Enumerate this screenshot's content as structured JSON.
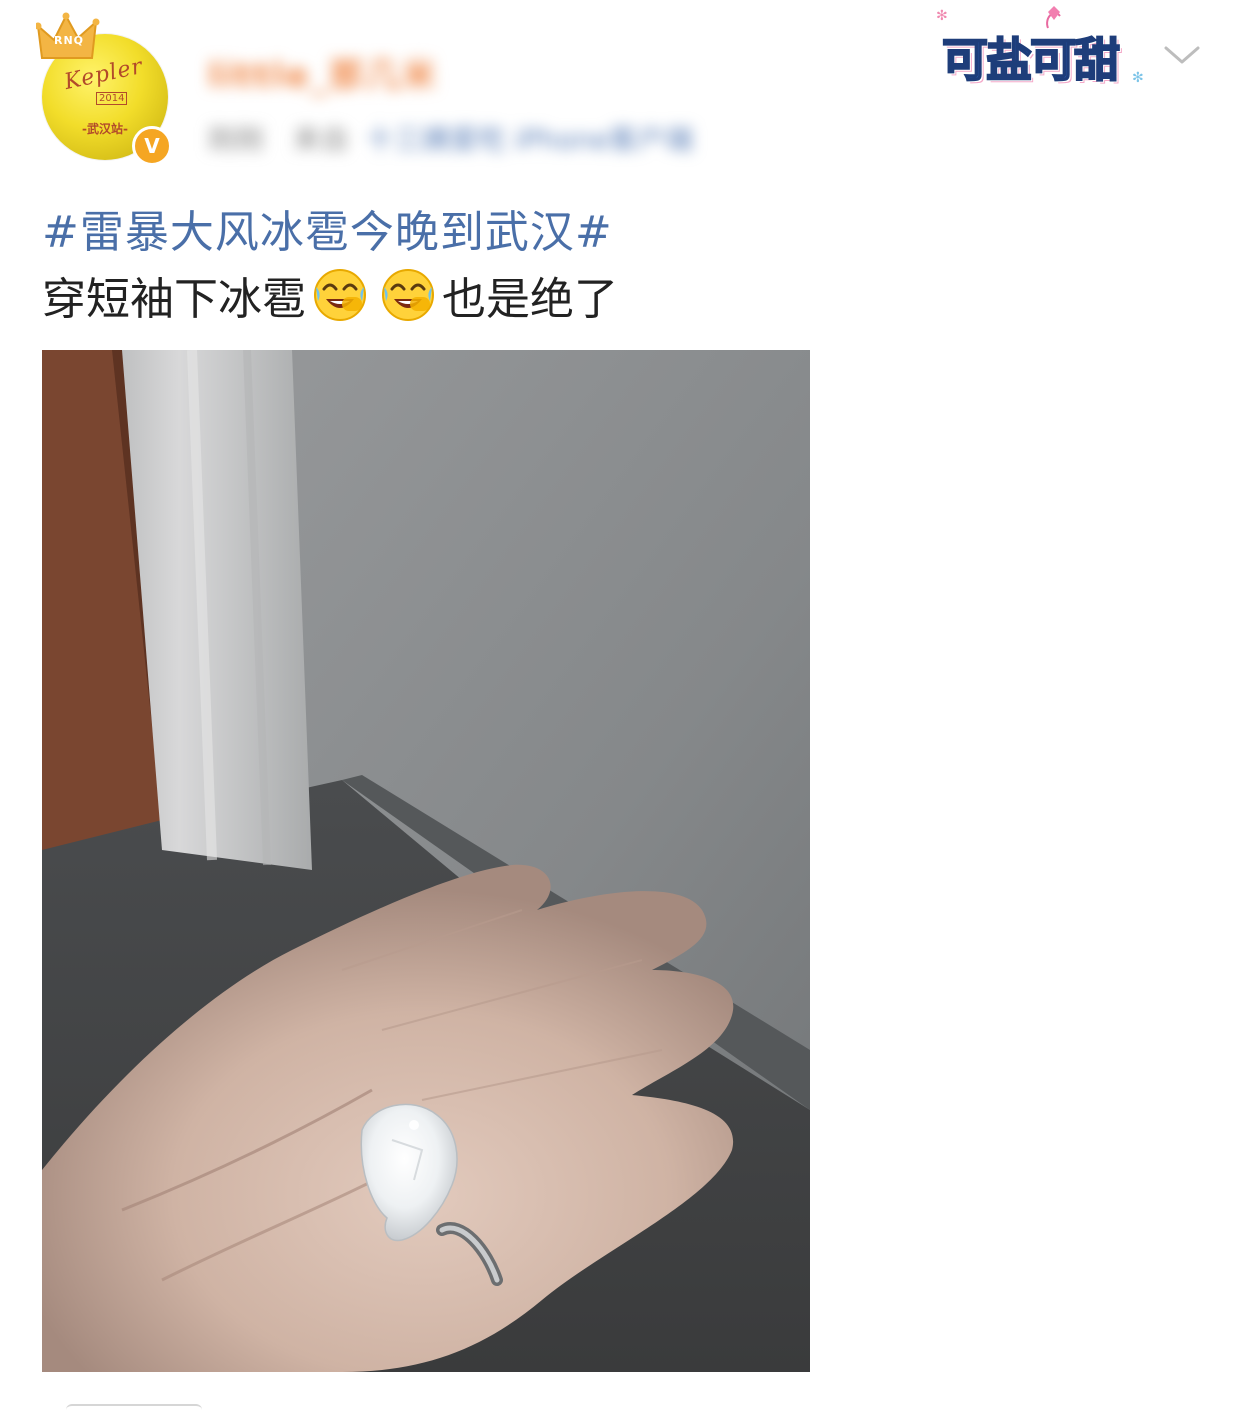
{
  "header": {
    "avatar": {
      "crown_badge": "RNQ",
      "script_text": "Kepler",
      "year_text": "2014",
      "city_text": "-武汉站-"
    },
    "verified_badge": "V",
    "username": "little_那几米",
    "meta": {
      "time": "刚刚",
      "from": "来自",
      "device": "十三姨爱吃 iPhone客户端"
    },
    "sticker_text": "可盐可甜"
  },
  "post": {
    "hashtag": "#雷暴大风冰雹今晚到武汉#",
    "text_before": "穿短袖下冰雹",
    "text_after": "也是绝了",
    "emoji_name": "laughing-crying-emoji"
  },
  "photo": {
    "subject": "hailstone-in-palm"
  },
  "colors": {
    "hashtag": "#4a6fa8",
    "username": "#f08a4b",
    "verified": "#f5a623",
    "body_text": "#222222"
  },
  "icons": [
    "crown-icon",
    "verified-icon",
    "chevron-down-icon",
    "laughing-crying-emoji"
  ]
}
